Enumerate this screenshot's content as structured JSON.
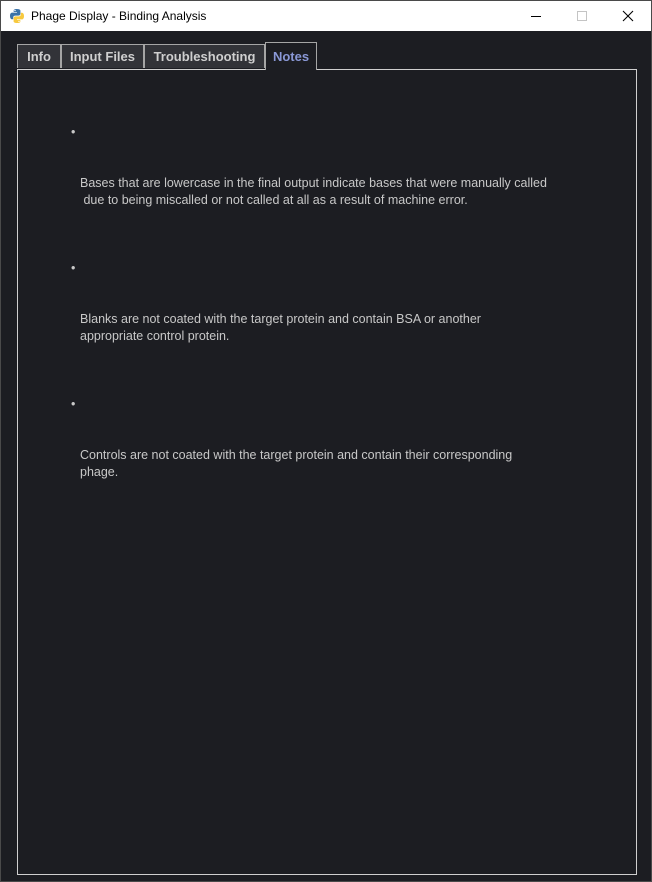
{
  "window": {
    "title": "Phage Display - Binding Analysis"
  },
  "tabs": [
    {
      "label": "Info",
      "active": false
    },
    {
      "label": "Input Files",
      "active": false
    },
    {
      "label": "Troubleshooting",
      "active": false
    },
    {
      "label": "Notes",
      "active": true
    }
  ],
  "notes": {
    "bullet": "•",
    "items": [
      "Bases that are lowercase in the final output indicate bases that were manually called\n due to being miscalled or not called at all as a result of machine error.",
      "Blanks are not coated with the target protein and contain BSA or another\nappropriate control protein.",
      "Controls are not coated with the target protein and contain their corresponding\nphage."
    ]
  },
  "colors": {
    "background": "#1c1d22",
    "tab_background": "#323338",
    "active_tab_text": "#8a98d6",
    "text": "#c8c8c8"
  }
}
